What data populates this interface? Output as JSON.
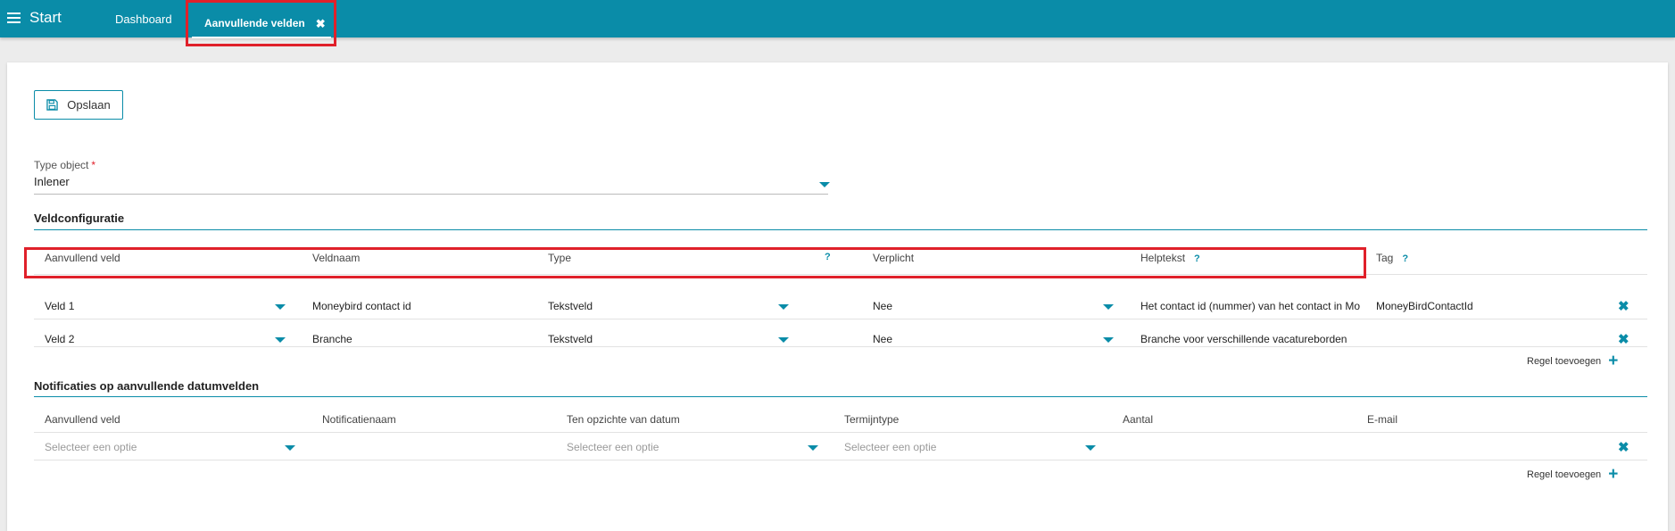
{
  "topbar": {
    "start_label": "Start",
    "tabs": [
      {
        "label": "Dashboard"
      },
      {
        "label": "Aanvullende velden"
      }
    ]
  },
  "toolbar": {
    "save_label": "Opslaan"
  },
  "type_object": {
    "label": "Type object",
    "required_marker": "*",
    "value": "Inlener"
  },
  "veldconfiguratie": {
    "title": "Veldconfiguratie",
    "headers": {
      "aanvullend_veld": "Aanvullend veld",
      "veldnaam": "Veldnaam",
      "type": "Type",
      "type_help": "?",
      "verplicht": "Verplicht",
      "helptekst": "Helptekst",
      "helptekst_help": "?",
      "tag": "Tag",
      "tag_help": "?"
    },
    "rows": [
      {
        "veld": "Veld 1",
        "veldnaam": "Moneybird contact id",
        "type": "Tekstveld",
        "verplicht": "Nee",
        "helptekst": "Het contact id (nummer) van het contact in Moneybird",
        "tag": "MoneyBirdContactId"
      },
      {
        "veld": "Veld 2",
        "veldnaam": "Branche",
        "type": "Tekstveld",
        "verplicht": "Nee",
        "helptekst": "Branche voor verschillende vacatureborden",
        "tag": ""
      }
    ],
    "add_row_label": "Regel toevoegen"
  },
  "notificaties": {
    "title": "Notificaties op aanvullende datumvelden",
    "headers": {
      "aanvullend_veld": "Aanvullend veld",
      "notificatienaam": "Notificatienaam",
      "ten_opzichte": "Ten opzichte van datum",
      "termijntype": "Termijntype",
      "aantal": "Aantal",
      "email": "E-mail"
    },
    "rows": [
      {
        "aanvullend_veld_placeholder": "Selecteer een optie",
        "ten_opzichte_placeholder": "Selecteer een optie",
        "termijntype_placeholder": "Selecteer een optie"
      }
    ],
    "add_row_label": "Regel toevoegen"
  },
  "colors": {
    "accent": "#0a8ca8",
    "highlight": "#e0202a"
  }
}
